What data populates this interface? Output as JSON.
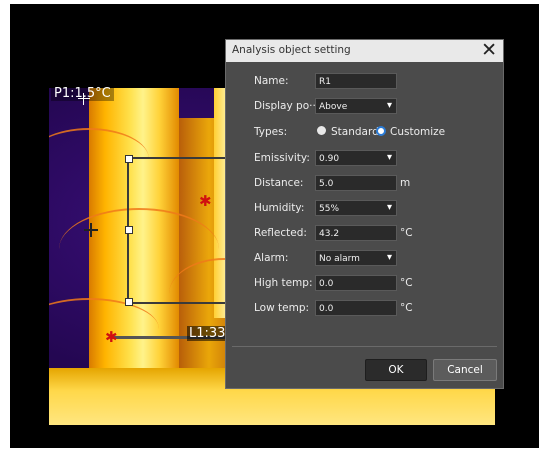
{
  "overlay": {
    "point_label": "P1:1.5°C",
    "line_label": "L1:33"
  },
  "dialog": {
    "title": "Analysis object setting",
    "close_glyph": "✕",
    "fields": {
      "name": {
        "label": "Name:",
        "value": "R1"
      },
      "display_position": {
        "label": "Display po···",
        "value": "Above"
      },
      "types": {
        "label": "Types:",
        "options": [
          "Standard",
          "Customize"
        ],
        "selected": "Customize"
      },
      "emissivity": {
        "label": "Emissivity:",
        "value": "0.90"
      },
      "distance": {
        "label": "Distance:",
        "value": "5.0",
        "unit": "m"
      },
      "humidity": {
        "label": "Humidity:",
        "value": "55%"
      },
      "reflected": {
        "label": "Reflected:",
        "value": "43.2",
        "unit": "°C"
      },
      "alarm": {
        "label": "Alarm:",
        "value": "No alarm"
      },
      "high_temp": {
        "label": "High temp:",
        "value": "0.0",
        "unit": "°C"
      },
      "low_temp": {
        "label": "Low temp:",
        "value": "0.0",
        "unit": "°C"
      }
    },
    "buttons": {
      "ok": "OK",
      "cancel": "Cancel"
    }
  },
  "colors": {
    "dialog_bg": "#4b4b4b",
    "title_bg": "#e9e9e9",
    "radio_selected": "#2a7bd6",
    "marker": "#d01010"
  }
}
